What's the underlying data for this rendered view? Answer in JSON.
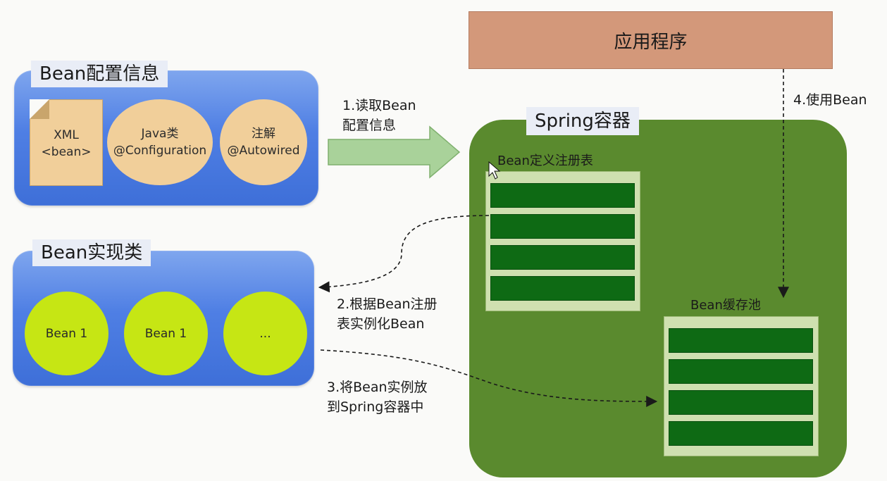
{
  "config_panel": {
    "title": "Bean配置信息",
    "xml_line1": "XML",
    "xml_line2": "<bean>",
    "java_line1": "Java类",
    "java_line2": "@Configuration",
    "anno_line1": "注解",
    "anno_line2": "@Autowired"
  },
  "impl_panel": {
    "title": "Bean实现类",
    "beans": [
      "Bean 1",
      "Bean 1",
      "..."
    ]
  },
  "app_box": {
    "label": "应用程序"
  },
  "spring_container": {
    "title": "Spring容器",
    "registry_label": "Bean定义注册表",
    "cache_label": "Bean缓存池"
  },
  "steps": {
    "step1_line1": "1.读取Bean",
    "step1_line2": "配置信息",
    "step2_line1": "2.根据Bean注册",
    "step2_line2": "表实例化Bean",
    "step3_line1": "3.将Bean实例放",
    "step3_line2": "到Spring容器中",
    "step4": "4.使用Bean"
  },
  "colors": {
    "blue_panel": "#4f7fe4",
    "tan": "#f1cf9a",
    "app_box": "#d3987a",
    "spring_green": "#5a8a2e",
    "row_green": "#0e6a14",
    "bean_yellow_green": "#c6e614",
    "arrow_green": "#a9d29a"
  }
}
